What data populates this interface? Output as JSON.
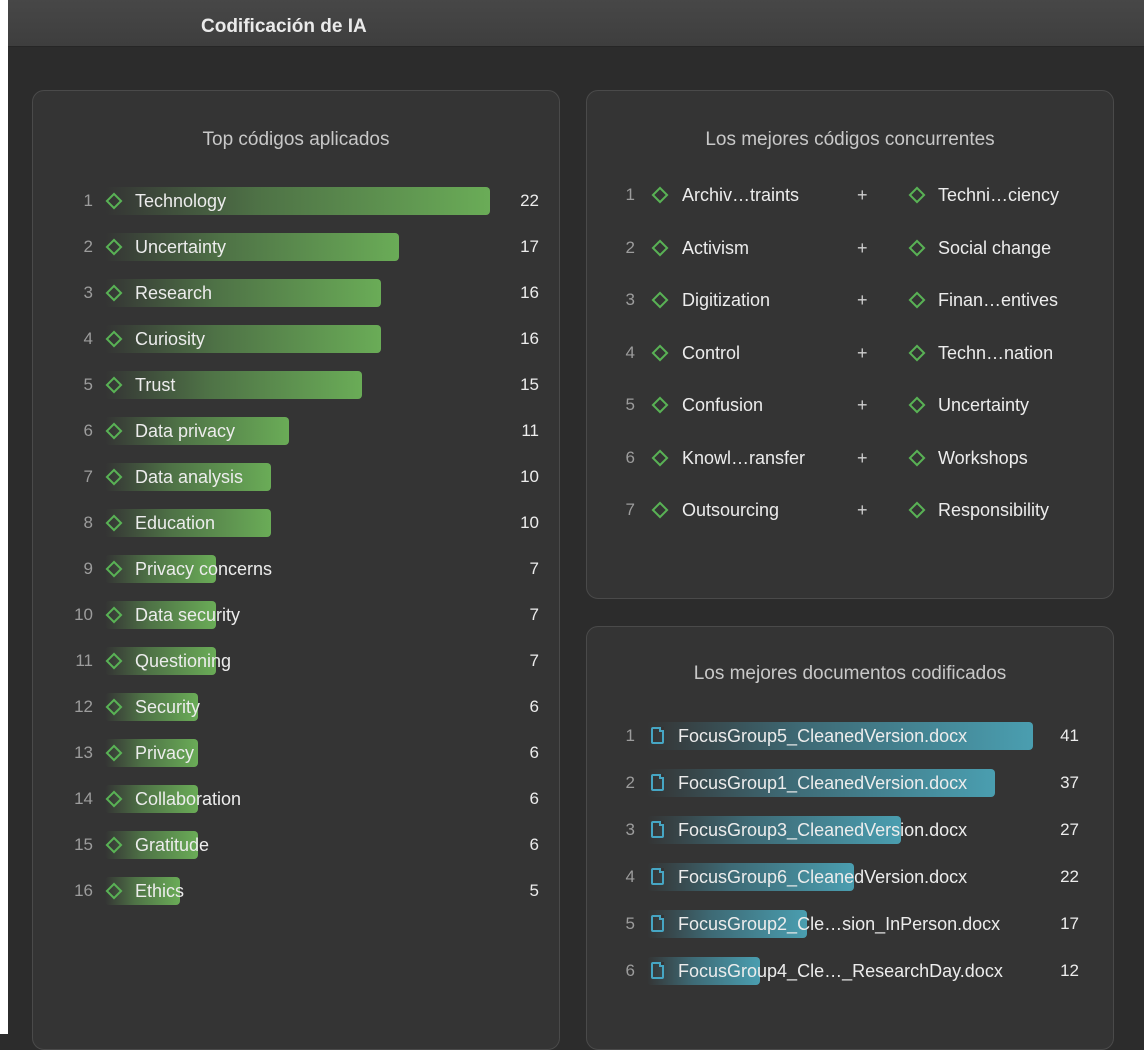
{
  "window": {
    "title": "Codificación de IA"
  },
  "colors": {
    "code_accent": "#59b255",
    "code_bar": "#6aac57",
    "doc_accent": "#46a6c4",
    "doc_bar": "#4a9eb0"
  },
  "icons": {
    "code": "diamond-icon",
    "document": "document-icon"
  },
  "top_codes": {
    "title": "Top códigos aplicados",
    "items": [
      {
        "rank": "1",
        "label": "Technology",
        "count": "22"
      },
      {
        "rank": "2",
        "label": "Uncertainty",
        "count": "17"
      },
      {
        "rank": "3",
        "label": "Research",
        "count": "16"
      },
      {
        "rank": "4",
        "label": "Curiosity",
        "count": "16"
      },
      {
        "rank": "5",
        "label": "Trust",
        "count": "15"
      },
      {
        "rank": "6",
        "label": "Data privacy",
        "count": "11"
      },
      {
        "rank": "7",
        "label": "Data analysis",
        "count": "10"
      },
      {
        "rank": "8",
        "label": "Education",
        "count": "10"
      },
      {
        "rank": "9",
        "label": "Privacy concerns",
        "count": "7"
      },
      {
        "rank": "10",
        "label": "Data security",
        "count": "7"
      },
      {
        "rank": "11",
        "label": "Questioning",
        "count": "7"
      },
      {
        "rank": "12",
        "label": "Security",
        "count": "6"
      },
      {
        "rank": "13",
        "label": "Privacy",
        "count": "6"
      },
      {
        "rank": "14",
        "label": "Collaboration",
        "count": "6"
      },
      {
        "rank": "15",
        "label": "Gratitude",
        "count": "6"
      },
      {
        "rank": "16",
        "label": "Ethics",
        "count": "5"
      }
    ]
  },
  "cooccurring": {
    "title": "Los mejores códigos concurrentes",
    "plus": "+",
    "items": [
      {
        "rank": "1",
        "a": "Archiv…traints",
        "b": "Techni…ciency"
      },
      {
        "rank": "2",
        "a": "Activism",
        "b": "Social change"
      },
      {
        "rank": "3",
        "a": "Digitization",
        "b": "Finan…entives"
      },
      {
        "rank": "4",
        "a": "Control",
        "b": "Techn…nation"
      },
      {
        "rank": "5",
        "a": "Confusion",
        "b": "Uncertainty"
      },
      {
        "rank": "6",
        "a": "Knowl…ransfer",
        "b": "Workshops"
      },
      {
        "rank": "7",
        "a": "Outsourcing",
        "b": "Responsibility"
      }
    ]
  },
  "top_documents": {
    "title": "Los mejores documentos codificados",
    "items": [
      {
        "rank": "1",
        "label": "FocusGroup5_CleanedVersion.docx",
        "count": "41"
      },
      {
        "rank": "2",
        "label": "FocusGroup1_CleanedVersion.docx",
        "count": "37"
      },
      {
        "rank": "3",
        "label": "FocusGroup3_CleanedVersion.docx",
        "count": "27"
      },
      {
        "rank": "4",
        "label": "FocusGroup6_CleanedVersion.docx",
        "count": "22"
      },
      {
        "rank": "5",
        "label": "FocusGroup2_Cle…sion_InPerson.docx",
        "count": "17"
      },
      {
        "rank": "6",
        "label": "FocusGroup4_Cle…_ResearchDay.docx",
        "count": "12"
      }
    ]
  }
}
